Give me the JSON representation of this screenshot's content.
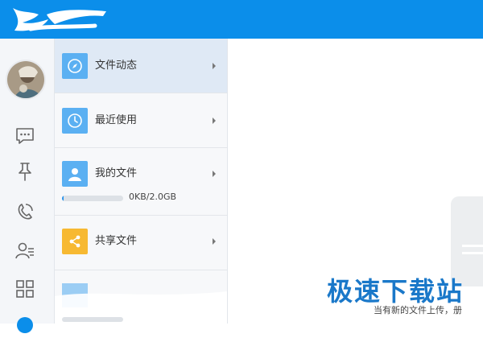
{
  "app": {
    "brand_color": "#0b8eea"
  },
  "rail": {
    "icons": [
      "chat-icon",
      "pin-icon",
      "phone-icon",
      "contacts-icon",
      "apps-grid-icon",
      "user-icon"
    ]
  },
  "panel": {
    "items": [
      {
        "label": "文件动态",
        "icon": "compass-icon",
        "icon_color": "#5bb0f2"
      },
      {
        "label": "最近使用",
        "icon": "clock-icon",
        "icon_color": "#5bb0f2"
      },
      {
        "label": "我的文件",
        "icon": "user-icon",
        "icon_color": "#5bb0f2"
      },
      {
        "label": "共享文件",
        "icon": "share-icon",
        "icon_color": "#f7b932"
      }
    ],
    "storage": {
      "used_text": "0KB/2.0GB",
      "fraction_used": 0.01
    }
  },
  "watermark": {
    "text": "极速下载站"
  },
  "toast": {
    "text": "当有新的文件上传，册"
  }
}
